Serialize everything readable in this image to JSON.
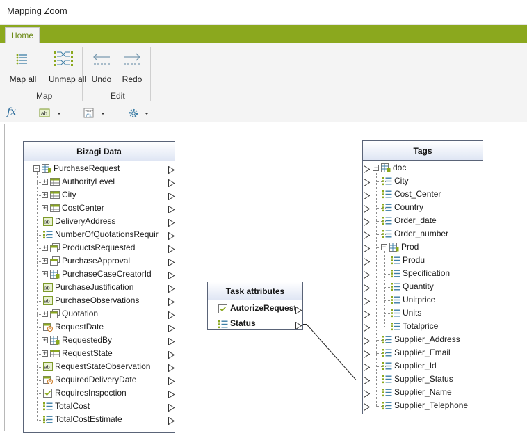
{
  "window": {
    "title": "Mapping Zoom"
  },
  "ribbon": {
    "tab_home": "Home",
    "map_all": "Map all",
    "unmap_all": "Unmap all",
    "group_map": "Map",
    "undo": "Undo",
    "redo": "Redo",
    "group_edit": "Edit"
  },
  "toolbar": {
    "fx": "fx",
    "icons": [
      "fx-icon",
      "text-format-icon",
      "formula-icon",
      "settings-gear-icon"
    ]
  },
  "colors": {
    "ribbon_green": "#8ba81e",
    "panel_border": "#5a6478",
    "header_blue": "#dfe6f4"
  },
  "left_panel": {
    "title": "Bizagi Data",
    "items": [
      {
        "label": "PurchaseRequest",
        "icon": "entity-table-icon",
        "expander": "-",
        "level": 0
      },
      {
        "label": "AuthorityLevel",
        "icon": "table-icon",
        "expander": "+",
        "level": 1
      },
      {
        "label": "City",
        "icon": "table-icon",
        "expander": "+",
        "level": 1
      },
      {
        "label": "CostCenter",
        "icon": "table-icon",
        "expander": "+",
        "level": 1
      },
      {
        "label": "DeliveryAddress",
        "icon": "text-field-icon",
        "expander": "",
        "level": 1
      },
      {
        "label": "NumberOfQuotationsRequir",
        "icon": "number-list-icon",
        "expander": "",
        "level": 1
      },
      {
        "label": "ProductsRequested",
        "icon": "collection-icon",
        "expander": "+",
        "level": 1
      },
      {
        "label": "PurchaseApproval",
        "icon": "collection-icon",
        "expander": "+",
        "level": 1
      },
      {
        "label": "PurchaseCaseCreatorId",
        "icon": "entity-table-icon",
        "expander": "+",
        "level": 1
      },
      {
        "label": "PurchaseJustification",
        "icon": "text-field-icon",
        "expander": "",
        "level": 1
      },
      {
        "label": "PurchaseObservations",
        "icon": "text-field-icon",
        "expander": "",
        "level": 1
      },
      {
        "label": "Quotation",
        "icon": "collection-icon",
        "expander": "+",
        "level": 1
      },
      {
        "label": "RequestDate",
        "icon": "date-icon",
        "expander": "",
        "level": 1
      },
      {
        "label": "RequestedBy",
        "icon": "entity-table-icon",
        "expander": "+",
        "level": 1
      },
      {
        "label": "RequestState",
        "icon": "table-icon",
        "expander": "+",
        "level": 1
      },
      {
        "label": "RequestStateObservation",
        "icon": "text-field-icon",
        "expander": "",
        "level": 1
      },
      {
        "label": "RequiredDeliveryDate",
        "icon": "date-icon",
        "expander": "",
        "level": 1
      },
      {
        "label": "RequiresInspection",
        "icon": "checkbox-icon",
        "expander": "",
        "level": 1
      },
      {
        "label": "TotalCost",
        "icon": "number-list-icon",
        "expander": "",
        "level": 1
      },
      {
        "label": "TotalCostEstimate",
        "icon": "number-list-icon",
        "expander": "",
        "level": 1
      }
    ]
  },
  "middle_panel": {
    "title": "Task attributes",
    "items": [
      {
        "label": "AutorizeRequest",
        "icon": "checkbox-icon"
      },
      {
        "label": "Status",
        "icon": "number-list-icon"
      }
    ]
  },
  "right_panel": {
    "title": "Tags",
    "items": [
      {
        "label": "doc",
        "icon": "entity-table-icon",
        "expander": "-",
        "level": 0
      },
      {
        "label": "City",
        "icon": "number-list-icon",
        "expander": "",
        "level": 1
      },
      {
        "label": "Cost_Center",
        "icon": "number-list-icon",
        "expander": "",
        "level": 1
      },
      {
        "label": "Country",
        "icon": "number-list-icon",
        "expander": "",
        "level": 1
      },
      {
        "label": "Order_date",
        "icon": "number-list-icon",
        "expander": "",
        "level": 1
      },
      {
        "label": "Order_number",
        "icon": "number-list-icon",
        "expander": "",
        "level": 1
      },
      {
        "label": "Prod",
        "icon": "entity-table-icon",
        "expander": "-",
        "level": 1
      },
      {
        "label": "Produ",
        "icon": "number-list-icon",
        "expander": "",
        "level": 2
      },
      {
        "label": "Specification",
        "icon": "number-list-icon",
        "expander": "",
        "level": 2
      },
      {
        "label": "Quantity",
        "icon": "number-list-icon",
        "expander": "",
        "level": 2
      },
      {
        "label": "Unitprice",
        "icon": "number-list-icon",
        "expander": "",
        "level": 2
      },
      {
        "label": "Units",
        "icon": "number-list-icon",
        "expander": "",
        "level": 2
      },
      {
        "label": "Totalprice",
        "icon": "number-list-icon",
        "expander": "",
        "level": 2
      },
      {
        "label": "Supplier_Address",
        "icon": "number-list-icon",
        "expander": "",
        "level": 1
      },
      {
        "label": "Supplier_Email",
        "icon": "number-list-icon",
        "expander": "",
        "level": 1
      },
      {
        "label": "Supplier_Id",
        "icon": "number-list-icon",
        "expander": "",
        "level": 1
      },
      {
        "label": "Supplier_Status",
        "icon": "number-list-icon",
        "expander": "",
        "level": 1
      },
      {
        "label": "Supplier_Name",
        "icon": "number-list-icon",
        "expander": "",
        "level": 1
      },
      {
        "label": "Supplier_Telephone",
        "icon": "number-list-icon",
        "expander": "",
        "level": 1
      }
    ]
  },
  "mappings": [
    {
      "from": "Status",
      "to": "Supplier_Status"
    }
  ]
}
